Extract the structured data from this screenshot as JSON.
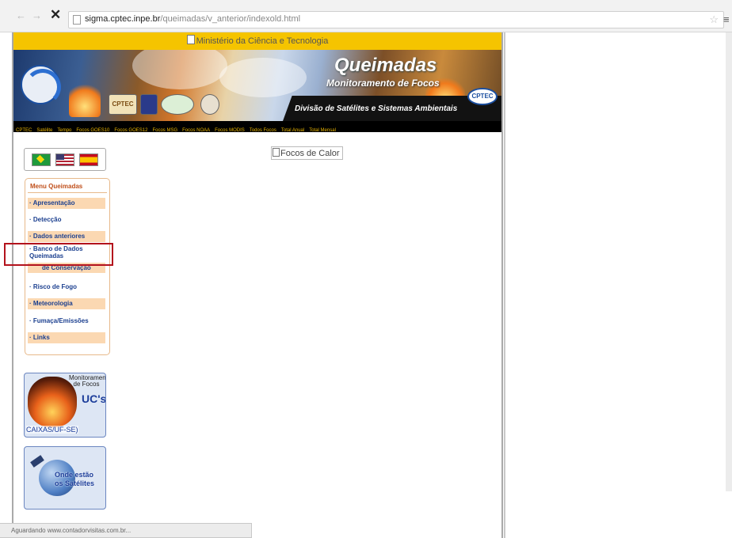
{
  "browser": {
    "url_host": "sigma.cptec.inpe.br",
    "url_path": "/queimadas/v_anterior/indexold.html",
    "back_icon": "back-arrow-icon",
    "forward_icon": "forward-arrow-icon",
    "stop_icon": "close-icon",
    "status_text": "Aguardando www.contadorvisitas.com.br..."
  },
  "header": {
    "ministry": "Ministério da Ciência e Tecnologia",
    "title": "Queimadas",
    "subtitle": "Monitoramento de Focos",
    "division": "Divisão de Satélites e Sistemas Ambientais",
    "cptec_logo": "CPTEC"
  },
  "topnav": [
    "CPTEC",
    "Satélite",
    "Tempo",
    "Focos GOES10",
    "Focos GOES12",
    "Focos MSG",
    "Focos NOAA",
    "Focos MODIS",
    "Todos Focos",
    "Total Anual",
    "Total Mensal"
  ],
  "menu": {
    "title": "Menu Queimadas",
    "items": [
      {
        "label": "· Apresentação"
      },
      {
        "label": "· Detecção"
      },
      {
        "label": "· Dados anteriores"
      },
      {
        "label": "· Banco de Dados Queimadas"
      },
      {
        "label": "de Conservação"
      },
      {
        "label": "· Risco de Fogo"
      },
      {
        "label": "· Meteorologia"
      },
      {
        "label": "· Fumaça/Emissões"
      },
      {
        "label": "· Links"
      }
    ]
  },
  "panel_fire": {
    "line1": "Monitoramento de Focos",
    "line2": "UC's",
    "line3": "CAIXAS/UF-SE)"
  },
  "panel_sat": {
    "line1": "Onde estão",
    "line2": "os Satélites"
  },
  "main": {
    "image_alt": "Focos de Calor"
  },
  "colors": {
    "ministry_bar": "#f5c400",
    "menu_link": "#1b3f8f",
    "menu_highlight": "#fbd8b2",
    "annotation": "#b3121c"
  }
}
